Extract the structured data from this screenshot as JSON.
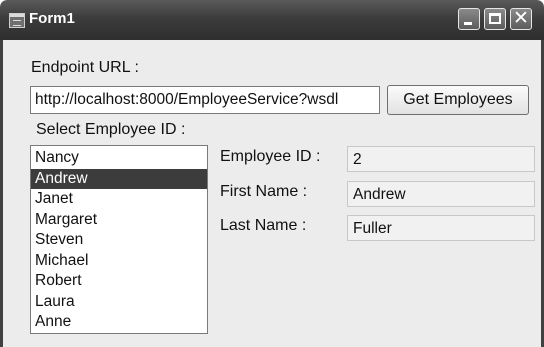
{
  "window": {
    "title": "Form1",
    "icons": {
      "app": "form-app-icon",
      "minimize": "minimize-icon",
      "maximize": "maximize-icon",
      "close": "close-icon"
    },
    "close_glyph": "✕"
  },
  "endpoint": {
    "label": "Endpoint URL :",
    "value": "http://localhost:8000/EmployeeService?wsdl"
  },
  "get_button_label": "Get Employees",
  "list": {
    "label": "Select Employee ID :",
    "items": [
      "Nancy",
      "Andrew",
      "Janet",
      "Margaret",
      "Steven",
      "Michael",
      "Robert",
      "Laura",
      "Anne"
    ],
    "selected": "Andrew"
  },
  "details": {
    "employee_id_label": "Employee ID :",
    "employee_id_value": "2",
    "first_name_label": "First Name :",
    "first_name_value": "Andrew",
    "last_name_label": "Last Name :",
    "last_name_value": "Fuller"
  },
  "colors": {
    "titlebar": "#3c3c3c",
    "selection": "#3c3c3c",
    "form_background": "#ececec"
  }
}
